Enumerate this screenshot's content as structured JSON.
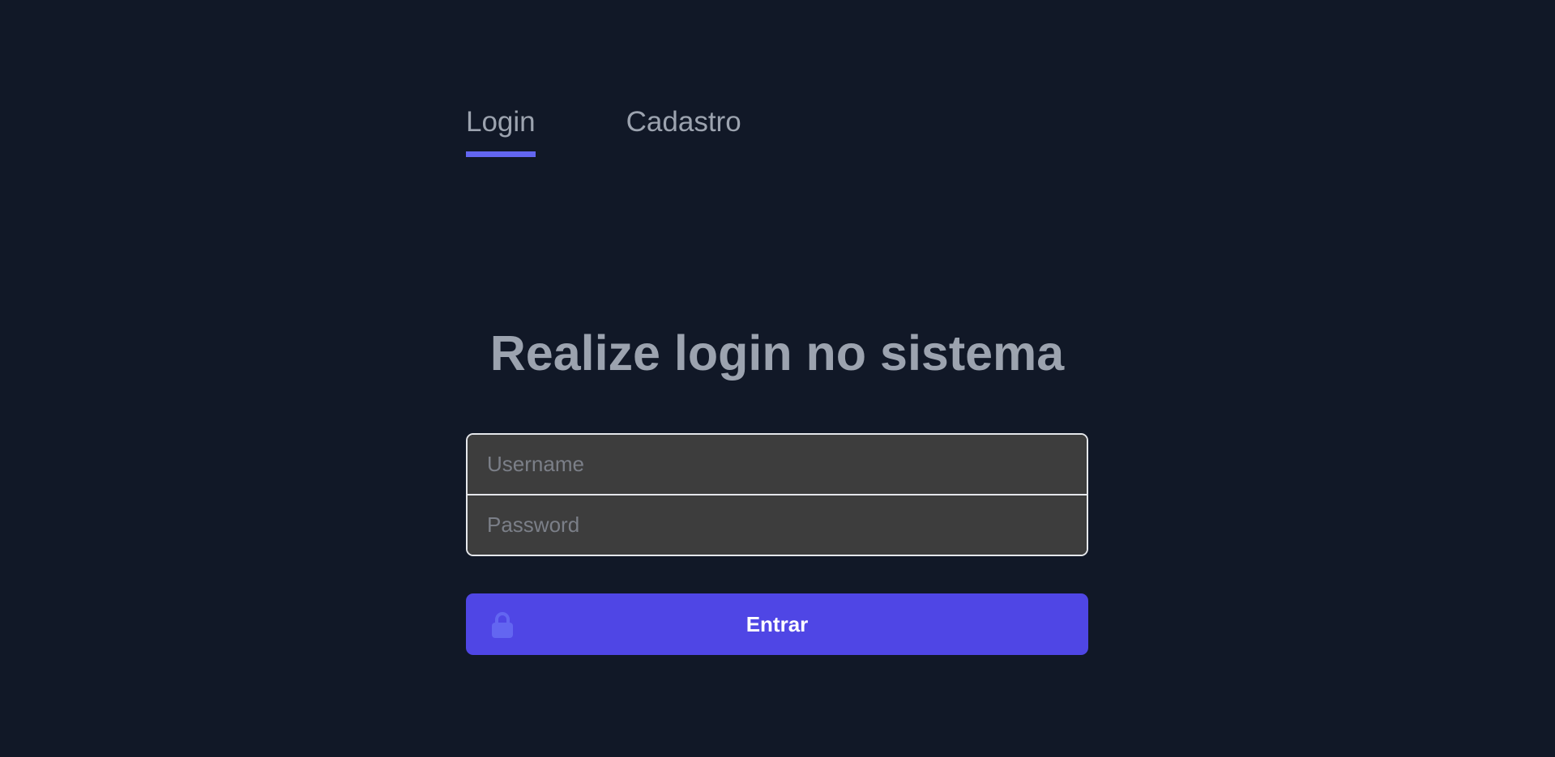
{
  "tabs": [
    {
      "label": "Login",
      "active": true
    },
    {
      "label": "Cadastro",
      "active": false
    }
  ],
  "heading": "Realize login no sistema",
  "form": {
    "username_placeholder": "Username",
    "password_placeholder": "Password",
    "username_value": "",
    "password_value": ""
  },
  "submit": {
    "label": "Entrar",
    "icon": "lock-icon"
  },
  "colors": {
    "background": "#111827",
    "accent": "#4f46e5",
    "tab_indicator": "#6366f1",
    "text_muted": "#9ca3af",
    "input_bg": "#3d3d3d"
  }
}
